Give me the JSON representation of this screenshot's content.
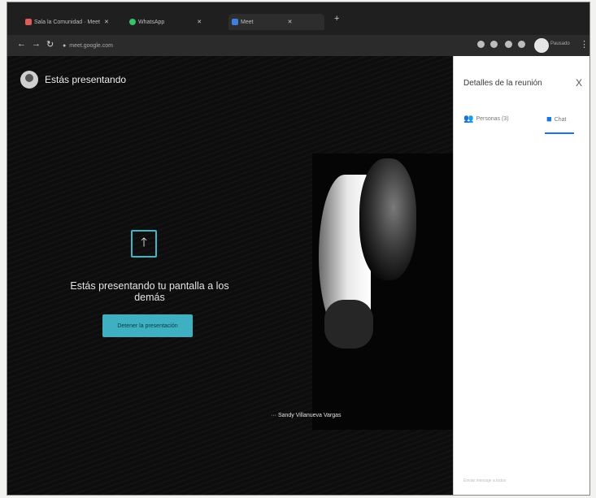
{
  "tabs": [
    {
      "label": "Sala la Comunidad · Meet",
      "color": "#e05a5a",
      "active": false
    },
    {
      "label": "WhatsApp",
      "color": "#35c46a",
      "active": false
    },
    {
      "label": "Meet",
      "color": "#3d7fe0",
      "active": true
    }
  ],
  "address": {
    "url": "meet.google.com"
  },
  "profile": {
    "label": "Pausado"
  },
  "stage": {
    "presenting_label": "Estás presentando",
    "message": "Estás presentando tu pantalla a los demás",
    "stop_button": "Detener la presentación",
    "participant_name": "Sandy Villanueva Vargas"
  },
  "panel": {
    "title": "Detalles de la reunión",
    "close": "X",
    "tab_people": "Personas (3)",
    "tab_chat": "Chat",
    "footer": "Enviar mensaje a todos"
  },
  "colors": {
    "accent": "#3fb0c2",
    "chat_blue": "#1a73e8"
  }
}
